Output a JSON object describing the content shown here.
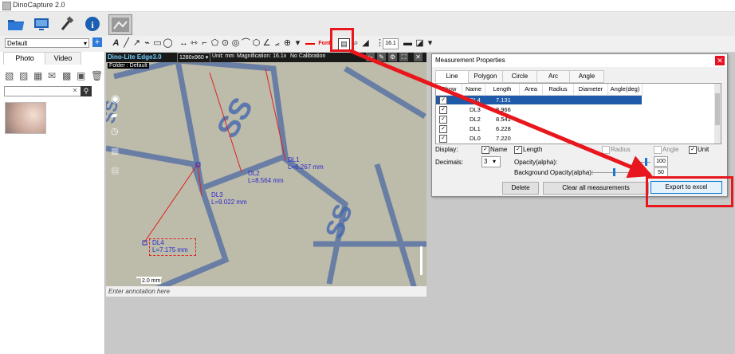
{
  "window": {
    "title": "DinoCapture 2.0"
  },
  "toolbar2": {
    "profile_value": "Default",
    "mag_value": "16.1"
  },
  "left_panel": {
    "tabs": [
      "Photo",
      "Video"
    ]
  },
  "viewer": {
    "device_name": "Dino-Lite Edge3.0",
    "resolution": "1280x960",
    "unit": "Unit: mm",
    "magnification": "Magnification: 16.1x",
    "calibration": "No Calibration",
    "folder": "Folder : Default",
    "scale_bar": "2.0 mm",
    "annotation_placeholder": "Enter annotation here",
    "measurements": [
      {
        "name": "DL1",
        "value": "L=6.267 mm"
      },
      {
        "name": "DL2",
        "value": "L=8.564 mm"
      },
      {
        "name": "DL3",
        "value": "L=9.022 mm"
      },
      {
        "name": "DL4",
        "value": "L=7.175 mm"
      }
    ]
  },
  "dialog": {
    "title": "Measurement Properties",
    "tabs": [
      "Line",
      "Polygon",
      "Circle",
      "Arc",
      "Angle"
    ],
    "columns": [
      "Show",
      "Name",
      "Length",
      "Area",
      "Radius",
      "Diameter",
      "Angle(deg)"
    ],
    "rows": [
      {
        "name": "DL4",
        "length": "7.131",
        "selected": true
      },
      {
        "name": "DL3",
        "length": "8.966",
        "selected": false
      },
      {
        "name": "DL2",
        "length": "8.541",
        "selected": false
      },
      {
        "name": "DL1",
        "length": "6.228",
        "selected": false
      },
      {
        "name": "DL0",
        "length": "7.220",
        "selected": false
      }
    ],
    "display_label": "Display:",
    "name_cb": "Name",
    "length_cb": "Length",
    "radius_cb": "Radius",
    "angle_cb": "Angle",
    "unit_cb": "Unit",
    "decimals_label": "Decimals:",
    "decimals_value": "3",
    "opacity_label": "Opacity(alpha):",
    "opacity_value": "100",
    "bg_opacity_label": "Background Opacity(alpha):",
    "bg_opacity_value": "50",
    "delete_label": "Delete",
    "clear_label": "Clear all measurements",
    "export_label": "Export to excel"
  }
}
